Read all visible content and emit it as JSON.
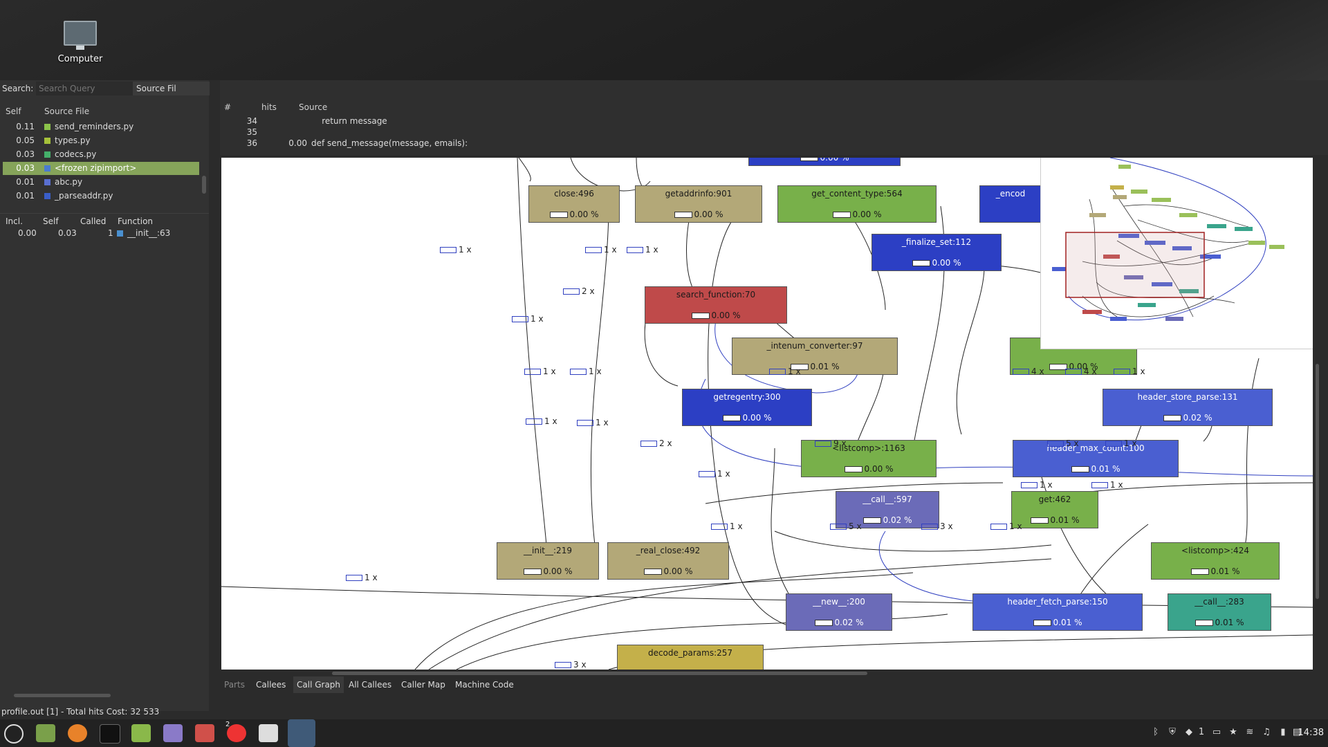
{
  "desktop": {
    "computer_label": "Computer"
  },
  "search": {
    "label": "Search:",
    "placeholder": "Search Query",
    "scope": "Source Fil"
  },
  "file_list": {
    "headers": {
      "self": "Self",
      "file": "Source File"
    },
    "rows": [
      {
        "self": "0.11",
        "name": "send_reminders.py",
        "color": "#8bc34a"
      },
      {
        "self": "0.05",
        "name": "types.py",
        "color": "#a6c23a"
      },
      {
        "self": "0.03",
        "name": "codecs.py",
        "color": "#44b06a"
      },
      {
        "self": "0.03",
        "name": "<frozen zipimport>",
        "color": "#4a7bd0",
        "selected": true
      },
      {
        "self": "0.01",
        "name": "abc.py",
        "color": "#5a6fd0"
      },
      {
        "self": "0.01",
        "name": "_parseaddr.py",
        "color": "#3a5ec8"
      }
    ]
  },
  "functions": {
    "headers": {
      "incl": "Incl.",
      "self": "Self",
      "called": "Called",
      "function": "Function"
    },
    "rows": [
      {
        "incl": "0.00",
        "self": "0.03",
        "called": "1",
        "name": "__init__:63"
      }
    ]
  },
  "source": {
    "headers": {
      "num": "#",
      "hits": "hits",
      "source": "Source"
    },
    "rows": [
      {
        "num": "34",
        "hits": "",
        "code": "    return message"
      },
      {
        "num": "35",
        "hits": "",
        "code": ""
      },
      {
        "num": "36",
        "hits": "0.00",
        "code": "def send_message(message, emails):"
      }
    ]
  },
  "graph": {
    "nodes": [
      {
        "id": "n-top",
        "name": "",
        "pct": "0.00 %",
        "color": "dblue"
      },
      {
        "id": "close",
        "name": "close:496",
        "pct": "0.00 %",
        "color": "tan"
      },
      {
        "id": "getaddrinfo",
        "name": "getaddrinfo:901",
        "pct": "0.00 %",
        "color": "tan"
      },
      {
        "id": "get_content_type",
        "name": "get_content_type:564",
        "pct": "0.00 %",
        "color": "green"
      },
      {
        "id": "encod",
        "name": "_encod",
        "pct": "",
        "color": "dblue"
      },
      {
        "id": "finalize_set",
        "name": "_finalize_set:112",
        "pct": "0.00 %",
        "color": "dblue"
      },
      {
        "id": "search_function",
        "name": "search_function:70",
        "pct": "0.00 %",
        "color": "red"
      },
      {
        "id": "intenum_converter",
        "name": "_intenum_converter:97",
        "pct": "0.01 %",
        "color": "tan"
      },
      {
        "id": "hidden-green",
        "name": "",
        "pct": "0.00 %",
        "color": "green"
      },
      {
        "id": "getregentry",
        "name": "getregentry:300",
        "pct": "0.00 %",
        "color": "dblue"
      },
      {
        "id": "header_store_parse",
        "name": "header_store_parse:131",
        "pct": "0.02 %",
        "color": "blue"
      },
      {
        "id": "listcomp1163",
        "name": "<listcomp>:1163",
        "pct": "0.00 %",
        "color": "green"
      },
      {
        "id": "header_max_count",
        "name": "header_max_count:100",
        "pct": "0.01 %",
        "color": "blue"
      },
      {
        "id": "call597",
        "name": "__call__:597",
        "pct": "0.02 %",
        "color": "purple"
      },
      {
        "id": "get462",
        "name": "get:462",
        "pct": "0.01 %",
        "color": "green"
      },
      {
        "id": "init219",
        "name": "__init__:219",
        "pct": "0.00 %",
        "color": "tan"
      },
      {
        "id": "real_close",
        "name": "_real_close:492",
        "pct": "0.00 %",
        "color": "tan"
      },
      {
        "id": "listcomp424",
        "name": "<listcomp>:424",
        "pct": "0.01 %",
        "color": "green"
      },
      {
        "id": "new200",
        "name": "__new__:200",
        "pct": "0.02 %",
        "color": "purple"
      },
      {
        "id": "header_fetch_parse",
        "name": "header_fetch_parse:150",
        "pct": "0.01 %",
        "color": "blue"
      },
      {
        "id": "call283",
        "name": "__call__:283",
        "pct": "0.01 %",
        "color": "teal"
      },
      {
        "id": "decode_params",
        "name": "decode_params:257",
        "pct": "",
        "color": "gold"
      }
    ],
    "edge_labels": [
      "1 x",
      "2 x",
      "1 x",
      "1 x",
      "1 x",
      "1 x",
      "1 x",
      "4 x",
      "4 x",
      "1 x",
      "1 x",
      "1 x",
      "1 x",
      "2 x",
      "9 x",
      "5 x",
      "1 x",
      "1 x",
      "1 x",
      "1 x",
      "1 x",
      "5 x",
      "3 x",
      "1 x",
      "1 x",
      "3 x"
    ]
  },
  "tabs": [
    "Parts",
    "Callees",
    "Call Graph",
    "All Callees",
    "Caller Map",
    "Machine Code"
  ],
  "active_tab": "Call Graph",
  "status": "profile.out [1] - Total hits Cost: 32 533",
  "clock": "14:38",
  "tray_count": "1",
  "taskbar_badge": "2"
}
